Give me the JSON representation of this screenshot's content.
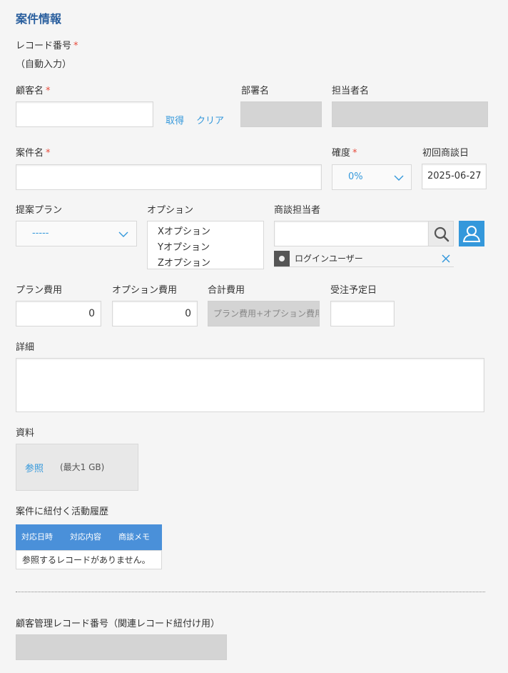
{
  "section": {
    "title": "案件情報"
  },
  "record_number": {
    "label": "レコード番号",
    "required": "*",
    "value": "（自動入力）"
  },
  "customer": {
    "label": "顧客名",
    "required": "*",
    "value": "",
    "get_link": "取得",
    "clear_link": "クリア"
  },
  "department": {
    "label": "部署名"
  },
  "person_in_charge": {
    "label": "担当者名"
  },
  "deal_name": {
    "label": "案件名",
    "required": "*",
    "value": ""
  },
  "certainty": {
    "label": "確度",
    "required": "*",
    "selected": "0%"
  },
  "first_meeting_date": {
    "label": "初回商談日",
    "value": "2025-06-27"
  },
  "proposal_plan": {
    "label": "提案プラン",
    "selected": "-----"
  },
  "options": {
    "label": "オプション",
    "items": [
      "Xオプション",
      "Yオプション",
      "Zオプション"
    ]
  },
  "deal_staff": {
    "label": "商談担当者",
    "search_value": "",
    "user_chip": "ログインユーザー"
  },
  "plan_cost": {
    "label": "プラン費用",
    "value": "0"
  },
  "option_cost": {
    "label": "オプション費用",
    "value": "0"
  },
  "total_cost": {
    "label": "合計費用",
    "placeholder": "プラン費用+オプション費用"
  },
  "order_date": {
    "label": "受注予定日",
    "value": ""
  },
  "details": {
    "label": "詳細",
    "value": ""
  },
  "materials": {
    "label": "資料",
    "browse": "参照",
    "max_size": "(最大1 GB)"
  },
  "activity_history": {
    "label": "案件に紐付く活動履歴",
    "columns": [
      "対応日時",
      "対応内容",
      "商談メモ"
    ],
    "empty": "参照するレコードがありません。",
    "header_color": "#4a90d9"
  },
  "customer_record": {
    "label": "顧客管理レコード番号（関連レコード紐付け用）",
    "value": ""
  },
  "colors": {
    "accent": "#3498db",
    "title": "#2a5f9e",
    "required": "#e74c3c"
  }
}
